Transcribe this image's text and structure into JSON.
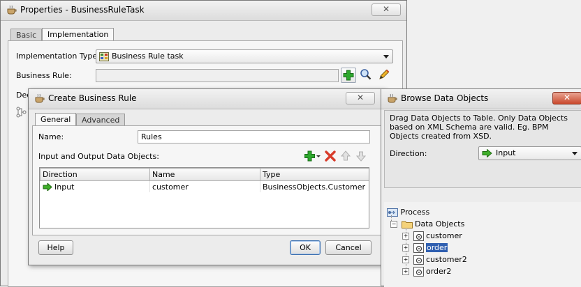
{
  "properties_dialog": {
    "title": "Properties - BusinessRuleTask",
    "close_label": "✕",
    "tabs": [
      {
        "label": "Basic"
      },
      {
        "label": "Implementation"
      }
    ],
    "impl_type_label": "Implementation Type:",
    "impl_type_value": "Business Rule task",
    "business_rule_label": "Business Rule:",
    "business_rule_value": "",
    "partial_label": "Dec"
  },
  "create_rule_dialog": {
    "title": "Create Business Rule",
    "close_label": "✕",
    "tabs": [
      {
        "label": "General"
      },
      {
        "label": "Advanced"
      }
    ],
    "name_label": "Name:",
    "name_value": "Rules",
    "io_label": "Input and Output Data Objects:",
    "columns": [
      "Direction",
      "Name",
      "Type"
    ],
    "rows": [
      {
        "direction": "Input",
        "name": "customer",
        "type": "BusinessObjects.Customer"
      }
    ],
    "help_label": "Help",
    "ok_label": "OK",
    "cancel_label": "Cancel"
  },
  "browse_dialog": {
    "title": "Browse Data Objects",
    "close_label": "✕",
    "description": "Drag Data Objects to Table. Only Data Objects based on XML Schema are valid. Eg. BPM Objects created from XSD.",
    "direction_label": "Direction:",
    "direction_value": "Input",
    "tree": {
      "root": "Process",
      "folder": "Data Objects",
      "items": [
        "customer",
        "order",
        "customer2",
        "order2"
      ],
      "selected": "order"
    }
  },
  "colors": {
    "selection": "#2f5fb0",
    "close_red": "#c9482b",
    "add_green": "#2ea82e",
    "delete_red": "#d83b2a"
  }
}
